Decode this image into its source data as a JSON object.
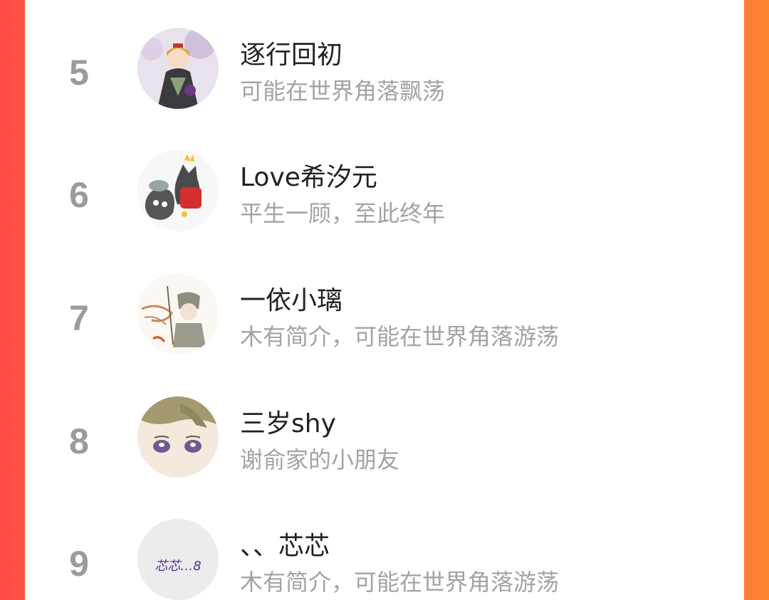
{
  "ranking": {
    "items": [
      {
        "rank": "5",
        "name": "逐行回初",
        "bio": "可能在世界角落飘荡",
        "avatar_icon": "avatar-anime-girl-kimono"
      },
      {
        "rank": "6",
        "name": "Love希汐元",
        "bio": "平生一顾，至此终年",
        "avatar_icon": "avatar-cartoon-wolves"
      },
      {
        "rank": "7",
        "name": "一依小璃",
        "bio": "木有简介，可能在世界角落游荡",
        "avatar_icon": "avatar-sketch-character"
      },
      {
        "rank": "8",
        "name": "三岁shy",
        "bio": "谢俞家的小朋友",
        "avatar_icon": "avatar-anime-child-face"
      },
      {
        "rank": "9",
        "name": "、、芯芯",
        "bio": "木有简介，可能在世界角落游荡",
        "avatar_icon": "avatar-handwritten-text",
        "avatar_text": "芯芯…8"
      }
    ]
  },
  "colors": {
    "bg_left": "#ff4b45",
    "bg_right": "#ff8630",
    "rank": "#9b9b9b",
    "name": "#222222",
    "bio": "#a3a3a3"
  }
}
